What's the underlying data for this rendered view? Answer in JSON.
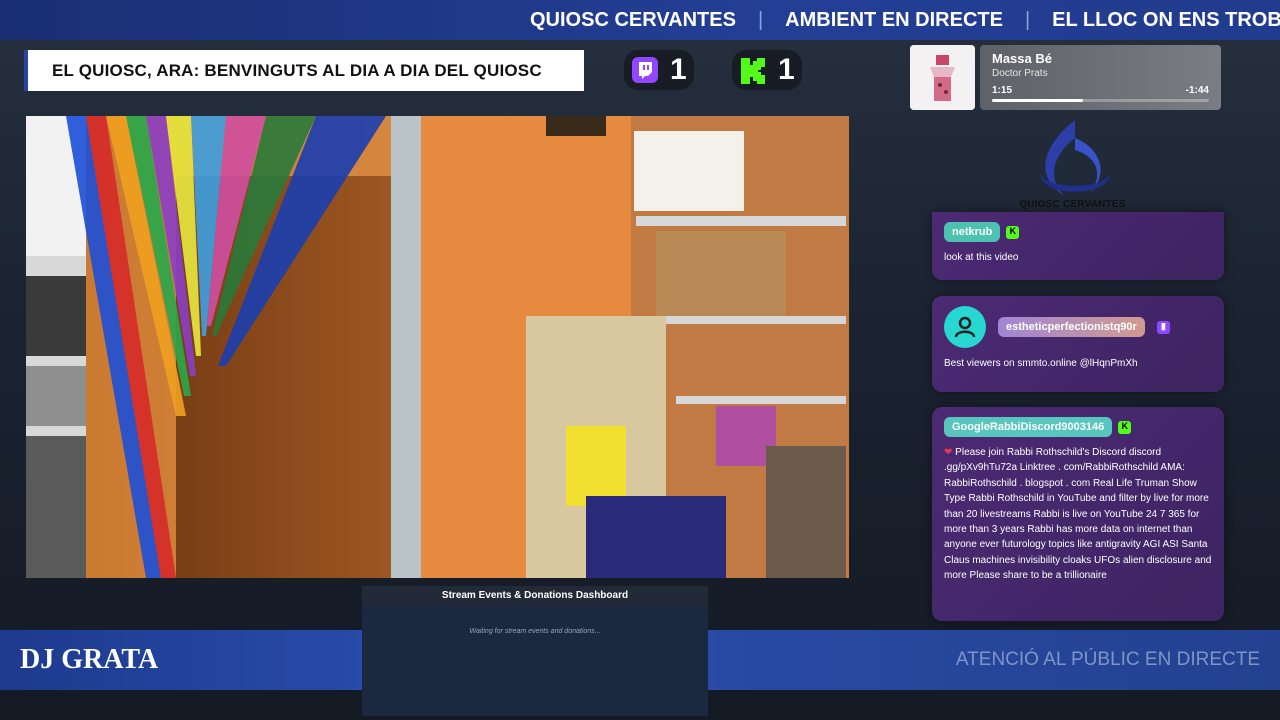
{
  "ticker": {
    "items": [
      "QUIOSC CERVANTES",
      "AMBIENT EN DIRECTE",
      "EL LLOC ON ENS TROBEM"
    ],
    "separator": "|"
  },
  "headline": "EL QUIOSC, ARA: BENVINGUTS AL DIA A DIA DEL QUIOSC",
  "viewers": {
    "twitch": "1",
    "kick": "1"
  },
  "now_playing": {
    "title": "Massa Bé",
    "artist": "Doctor Prats",
    "elapsed": "1:15",
    "remaining": "-1:44",
    "progress": 0.42
  },
  "logo": {
    "text": "QUIOSC CERVANTES"
  },
  "chat": [
    {
      "username": "netkrub",
      "platform": "kick",
      "badge_glyph": "K",
      "message": "look at this video"
    },
    {
      "username": "estheticperfectionistq90r",
      "platform": "twitch",
      "badge_glyph": "▮",
      "message": "Best viewers on smmto.online @lHqnPmXh"
    },
    {
      "username": "GoogleRabbiDiscord9003146",
      "platform": "kick",
      "badge_glyph": "K",
      "emoji": "❤",
      "message": "Please join Rabbi Rothschild's Discord discord .gg/pXv9hTu72a Linktree . com/RabbiRothschild AMA: RabbiRothschild . blogspot . com Real Life Truman Show Type Rabbi Rothschild in YouTube and filter by live for more than 20 livestreams Rabbi is live on YouTube 24 7 365 for more than 3 years Rabbi has more data on internet than anyone ever futurology topics like antigravity AGI ASI Santa Claus machines invisibility cloaks UFOs alien disclosure and more Please share to be a trillionaire"
    }
  ],
  "bottom_left": {
    "dj_name": "DJ GRATA"
  },
  "bottom_right": {
    "notice": "ATENCIÓ AL PÚBLIC EN DIRECTE"
  },
  "dashboard": {
    "title": "Stream Events & Donations Dashboard",
    "status": "Waiting for stream events and donations..."
  },
  "colors": {
    "ticker_bg": "#233f95",
    "twitch": "#9146ff",
    "kick": "#53fc18",
    "chat_bg": "#4c2a74",
    "bottom_bar": "#284aa8"
  }
}
